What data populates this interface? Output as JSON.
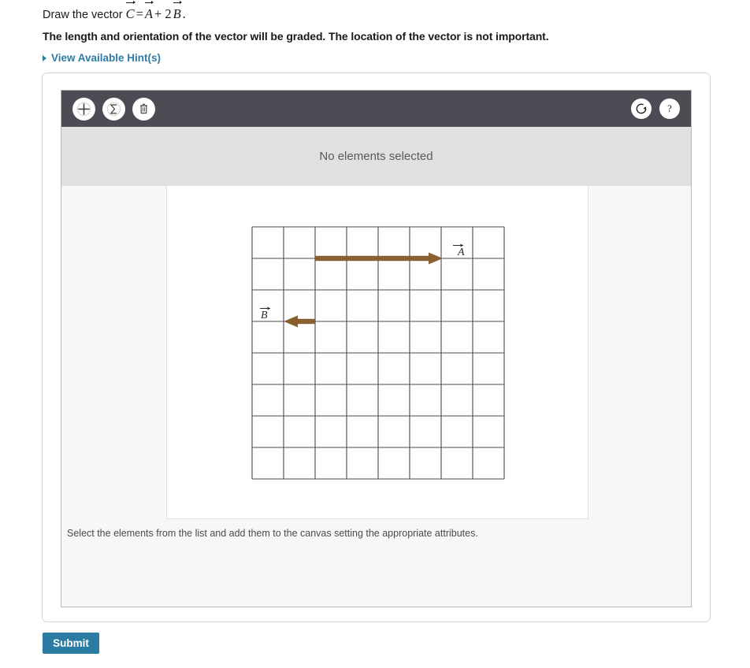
{
  "question": {
    "prompt_prefix": "Draw the vector",
    "equation": {
      "lhs": "C",
      "equals": "=",
      "term1": "A",
      "plus": "+",
      "coefficient": "2",
      "term2": "B",
      "period": "."
    },
    "subtitle": "The length and orientation of the vector will be graded. The location of the vector is not important.",
    "hint_link": "View Available Hint(s)"
  },
  "toolbar": {
    "add_label": "add-element",
    "sum_label": "sum-vectors",
    "delete_label": "delete-element",
    "reset_label": "reset-canvas",
    "help_label": "help",
    "icons": {
      "add": "plus-circle-icon",
      "sum": "sigma-circle-icon",
      "delete": "trash-circle-icon",
      "reset": "reset-circle-icon",
      "help": "help-circle-icon"
    },
    "background": "#4c4c55"
  },
  "status": {
    "text": "No elements selected",
    "background": "#e0e0e0"
  },
  "canvas": {
    "note": "Select the elements from the list and add them to the canvas setting the appropriate attributes.",
    "grid": {
      "columns": 8,
      "rows": 8,
      "cell_size": 40,
      "line_color": "#4a4a4a"
    },
    "vectors": [
      {
        "label": "A",
        "color": "#8b5e2e",
        "start_cell": [
          2,
          1
        ],
        "end_cell": [
          6,
          1
        ],
        "direction": "right",
        "length_cells": 4,
        "label_position": [
          6.6,
          1
        ]
      },
      {
        "label": "B",
        "color": "#8b5e2e",
        "start_cell": [
          2,
          3
        ],
        "end_cell": [
          1,
          3
        ],
        "direction": "left",
        "length_cells": 1,
        "label_position": [
          0.35,
          3
        ]
      }
    ]
  },
  "actions": {
    "submit_label": "Submit",
    "submit_color": "#2b7ba2"
  }
}
